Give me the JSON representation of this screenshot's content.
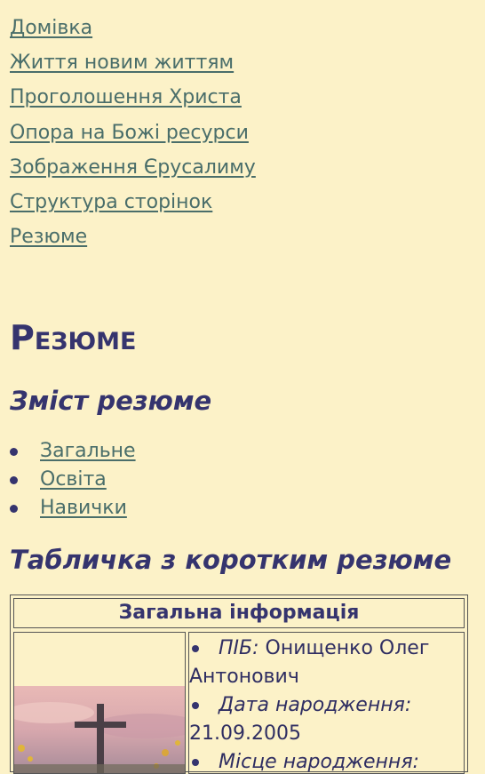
{
  "nav": {
    "items": [
      {
        "label": "Домівка"
      },
      {
        "label": "Життя новим життям"
      },
      {
        "label": "Проголошення Христа"
      },
      {
        "label": "Опора на Божі ресурси"
      },
      {
        "label": "Зображення Єрусалиму"
      },
      {
        "label": "Структура сторінок"
      },
      {
        "label": "Резюме"
      }
    ]
  },
  "page": {
    "title": "Резюме",
    "toc_heading": "Зміст резюме",
    "toc": [
      "Загальне",
      "Освіта",
      "Навички"
    ],
    "table_heading": "Табличка з коротким резюме"
  },
  "table": {
    "header": "Загальна інформація",
    "rows": [
      {
        "label": "ПІБ:",
        "value": "Онищенко Олег Антонович"
      },
      {
        "label": "Дата народження:",
        "value": "21.09.2005"
      },
      {
        "label": "Місце народження:",
        "value": ""
      }
    ]
  },
  "colors": {
    "background": "#fcf2c8",
    "link": "#4a6e6a",
    "heading": "#35346e"
  }
}
